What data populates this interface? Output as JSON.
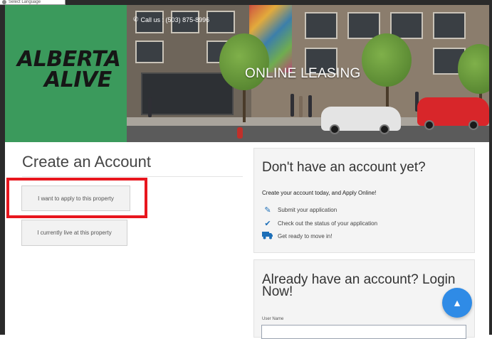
{
  "translate_widget": {
    "label": "Select Language"
  },
  "header": {
    "logo_line1": "ALBERTA",
    "logo_line2": "ALIVE",
    "call_label": "Call us : (503) 875-8996",
    "hero_title": "ONLINE LEASING"
  },
  "create_account": {
    "title": "Create an Account",
    "apply_button": "I want to apply to this property",
    "live_button": "I currently live at this property"
  },
  "signup_panel": {
    "title": "Don't have an account yet?",
    "subtitle": "Create your account today, and Apply Online!",
    "features": [
      {
        "icon": "pencil-icon",
        "label": "Submit your application"
      },
      {
        "icon": "checkmark-icon",
        "label": "Check out the status of your application"
      },
      {
        "icon": "truck-icon",
        "label": "Get ready to move in!"
      }
    ]
  },
  "login_panel": {
    "title": "Already have an account? Login Now!",
    "username_label": "User Name",
    "username_value": ""
  },
  "colors": {
    "logo_green": "#3b9a5c",
    "highlight_red": "#e8161e",
    "accent_blue": "#2f8be6",
    "icon_blue": "#1d6fb8"
  }
}
